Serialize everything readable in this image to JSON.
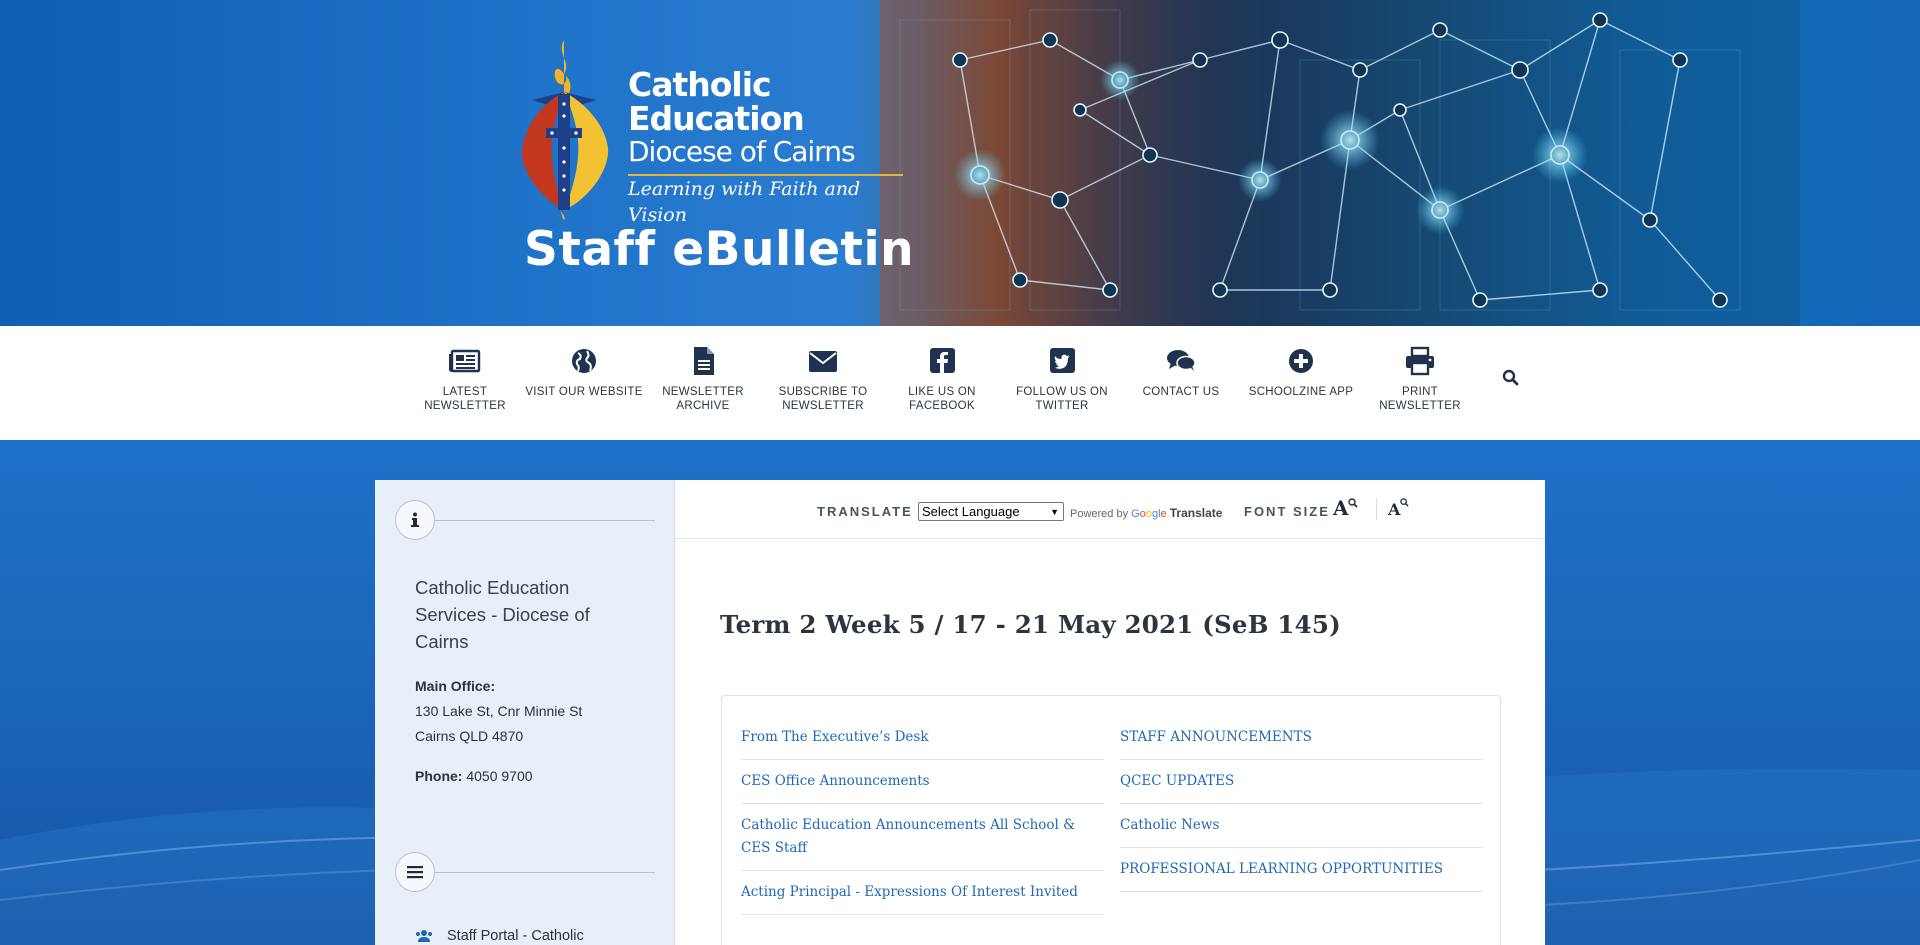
{
  "banner": {
    "logo_line1": "Catholic",
    "logo_line2": "Education",
    "logo_line3": "Diocese of Cairns",
    "logo_tagline": "Learning with Faith and Vision",
    "site_title": "Staff eBulletin"
  },
  "nav": {
    "items": [
      {
        "label": "LATEST NEWSLETTER",
        "icon": "newspaper-icon"
      },
      {
        "label": "VISIT OUR WEBSITE",
        "icon": "globe-icon"
      },
      {
        "label": "NEWSLETTER ARCHIVE",
        "icon": "file-icon"
      },
      {
        "label": "SUBSCRIBE TO NEWSLETTER",
        "icon": "envelope-icon"
      },
      {
        "label": "LIKE US ON FACEBOOK",
        "icon": "facebook-icon"
      },
      {
        "label": "FOLLOW US ON TWITTER",
        "icon": "twitter-icon"
      },
      {
        "label": "CONTACT US",
        "icon": "comments-icon"
      },
      {
        "label": "SCHOOLZINE APP",
        "icon": "plus-circle-icon"
      },
      {
        "label": "PRINT NEWSLETTER",
        "icon": "printer-icon"
      }
    ],
    "search_icon": "search-icon"
  },
  "sidebar": {
    "info_icon": "info-icon",
    "org_name": "Catholic Education Services - Diocese of Cairns",
    "main_office_label": "Main Office:",
    "address_line1": "130 Lake St, Cnr Minnie St",
    "address_line2": "Cairns QLD 4870",
    "phone_label": "Phone:",
    "phone_value": "4050 9700",
    "menu_icon": "menu-icon",
    "portal_icon": "users-icon",
    "portal_label": "Staff Portal - Catholic"
  },
  "toolbar": {
    "translate_label": "TRANSLATE",
    "language_select_value": "Select Language",
    "powered_by": "Powered by",
    "google_letters": [
      "G",
      "o",
      "o",
      "g",
      "l",
      "e"
    ],
    "translate_brand": "Translate",
    "font_size_label": "FONT SIZE",
    "font_increase": "A",
    "font_decrease": "A"
  },
  "main": {
    "issue_title": "Term 2 Week 5 / 17 - 21 May 2021 (SeB 145)",
    "toc_left": [
      "From The Executive’s Desk",
      "CES Office Announcements",
      "Catholic Education Announcements All School & CES Staff",
      "Acting Principal - Expressions Of Interest Invited"
    ],
    "toc_right": [
      "STAFF ANNOUNCEMENTS",
      "QCEC UPDATES",
      "Catholic News",
      "PROFESSIONAL LEARNING OPPORTUNITIES"
    ]
  },
  "colors": {
    "brand_blue": "#1d6ec4",
    "link_blue": "#1f68b4",
    "gold": "#e4b53a",
    "nav_text": "#2a3444"
  }
}
